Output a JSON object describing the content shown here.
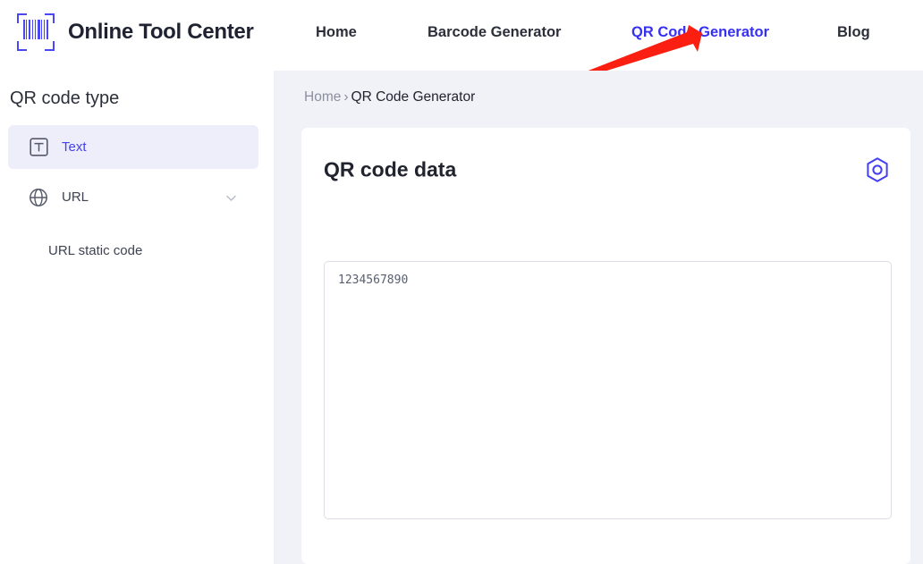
{
  "header": {
    "brand_name": "Online Tool Center",
    "logo_icon": "barcode-scan-icon",
    "nav": [
      {
        "label": "Home",
        "active": false
      },
      {
        "label": "Barcode Generator",
        "active": false
      },
      {
        "label": "QR Code Generator",
        "active": true
      },
      {
        "label": "Blog",
        "active": false
      }
    ]
  },
  "annotation": {
    "type": "arrow",
    "color": "#fb1f12",
    "points_to": "QR Code Generator"
  },
  "sidebar": {
    "title": "QR code type",
    "items": [
      {
        "label": "Text",
        "icon": "text-box-icon",
        "selected": true
      },
      {
        "label": "URL",
        "icon": "globe-icon",
        "selected": false,
        "expand_icon": "chevron-down-icon"
      },
      {
        "label": "URL static code",
        "icon": "",
        "selected": false,
        "is_child": true
      }
    ]
  },
  "content": {
    "breadcrumb": {
      "home": "Home",
      "separator": "›",
      "current": "QR Code Generator"
    },
    "card": {
      "title": "QR code data",
      "settings_icon": "hexagon-settings-icon",
      "textarea": {
        "value": "1234567890",
        "placeholder": ""
      }
    }
  },
  "colors": {
    "accent": "#4340ef",
    "nav_active": "#3730f0",
    "sidebar_selected_bg": "#eeeefb",
    "content_bg": "#f1f2f7",
    "card_bg": "#ffffff",
    "text_primary": "#21242f",
    "text_muted": "#8a8f9e",
    "annotation_red": "#fb1f12"
  }
}
